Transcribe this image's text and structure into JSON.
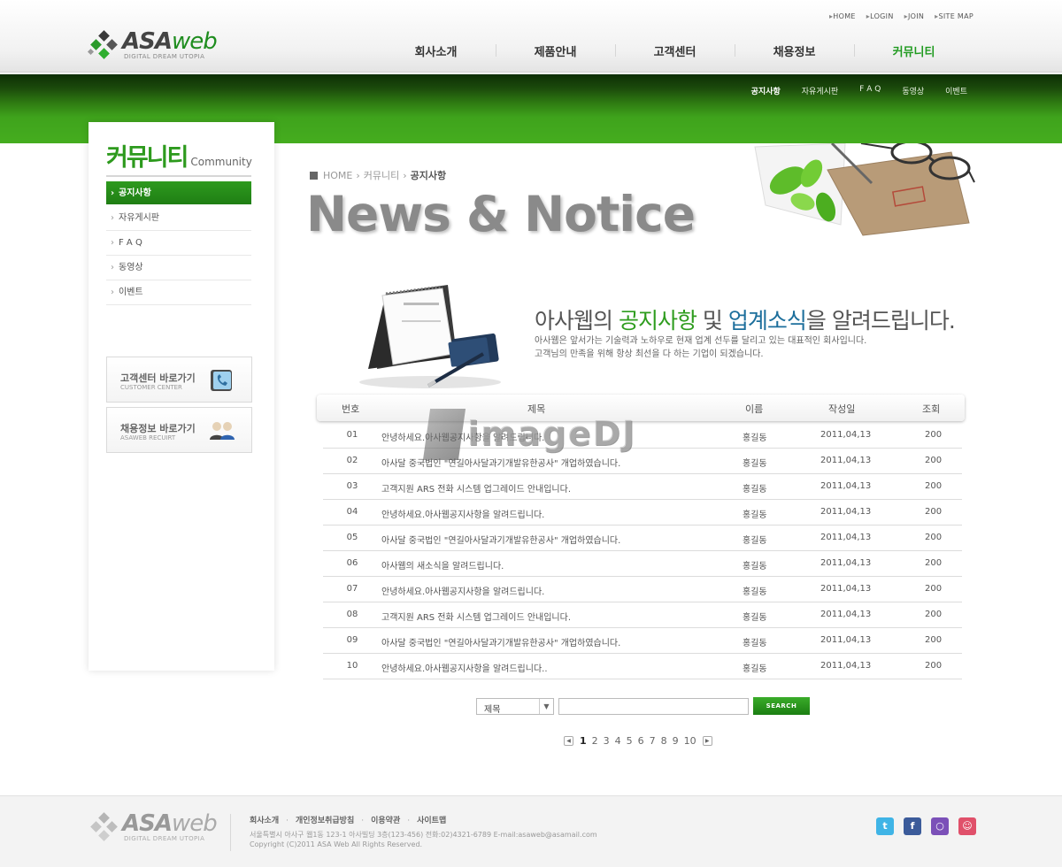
{
  "top_links": [
    "HOME",
    "LOGIN",
    "JOIN",
    "SITE MAP"
  ],
  "logo": {
    "main": "ASA",
    "accent": "web",
    "sub": "DIGITAL DREAM UTOPIA"
  },
  "gnb": [
    "회사소개",
    "제품안내",
    "고객센터",
    "채용정보",
    "커뮤니티"
  ],
  "gnb_active": "커뮤니티",
  "snb": [
    "공지사항",
    "자유게시판",
    "F A Q",
    "동영상",
    "이벤트"
  ],
  "lnb": {
    "title_kor": "커뮤니티",
    "title_eng": "Community",
    "items": [
      "공지사항",
      "자유게시판",
      "F A Q",
      "동영상",
      "이벤트"
    ]
  },
  "quick": [
    {
      "title": "고객센터 바로가기",
      "sub": "CUSTOMER CENTER",
      "icon": "phone-icon"
    },
    {
      "title": "채용정보 바로가기",
      "sub": "ASAWEB RECUIRT",
      "icon": "people-icon"
    }
  ],
  "breadcrumb": [
    "HOME",
    "커뮤니티",
    "공지사항"
  ],
  "page_title": "News & Notice",
  "headline": {
    "p1": "아사웹의 ",
    "p2": "공지사항",
    "p3": " 및 ",
    "p4": "업계소식",
    "p5": "을 알려드립니다."
  },
  "description": [
    "아사웹은 앞서가는 기술력과 노하우로 현재 업계 선두를 달리고 있는 대표적인 회사입니다.",
    "고객님의 만족을 위해 항상 최선을 다 하는 기업이 되겠습니다."
  ],
  "watermark": "imageDJ",
  "table": {
    "headers": [
      "번호",
      "제목",
      "이름",
      "작성일",
      "조회"
    ],
    "rows": [
      {
        "num": "01",
        "title": "안녕하세요.아사웹공지사항을 알려드립니다.",
        "name": "홍길동",
        "date": "2011,04,13",
        "views": "200"
      },
      {
        "num": "02",
        "title": "아사달 중국법인 \"연길아사달과기개발유한공사\" 개업하였습니다.",
        "name": "홍길동",
        "date": "2011,04,13",
        "views": "200"
      },
      {
        "num": "03",
        "title": "고객지원 ARS 전화 시스템 업그레이드 안내입니다.",
        "name": "홍길동",
        "date": "2011,04,13",
        "views": "200"
      },
      {
        "num": "04",
        "title": "안녕하세요.아사웹공지사항을 알려드립니다.",
        "name": "홍길동",
        "date": "2011,04,13",
        "views": "200"
      },
      {
        "num": "05",
        "title": "아사달 중국법인 \"연길아사달과기개발유한공사\" 개업하였습니다.",
        "name": "홍길동",
        "date": "2011,04,13",
        "views": "200"
      },
      {
        "num": "06",
        "title": "아사웹의 새소식을 알려드립니다.",
        "name": "홍길동",
        "date": "2011,04,13",
        "views": "200"
      },
      {
        "num": "07",
        "title": "안녕하세요.아사웹공지사항을 알려드립니다.",
        "name": "홍길동",
        "date": "2011,04,13",
        "views": "200"
      },
      {
        "num": "08",
        "title": "고객지원 ARS 전화 시스템 업그레이드 안내입니다.",
        "name": "홍길동",
        "date": "2011,04,13",
        "views": "200"
      },
      {
        "num": "09",
        "title": "아사달 중국법인 \"연길아사달과기개발유한공사\" 개업하였습니다.",
        "name": "홍길동",
        "date": "2011,04,13",
        "views": "200"
      },
      {
        "num": "10",
        "title": "안녕하세요.아사웹공지사항을 알려드립니다..",
        "name": "홍길동",
        "date": "2011,04,13",
        "views": "200"
      }
    ]
  },
  "search": {
    "select_value": "제목",
    "input_value": "",
    "button_label": "SEARCH"
  },
  "pagination": {
    "pages": [
      "1",
      "2",
      "3",
      "4",
      "5",
      "6",
      "7",
      "8",
      "9",
      "10"
    ],
    "current": "1"
  },
  "footer": {
    "links": [
      "회사소개",
      "개인정보취급방침",
      "이용약관",
      "사이트맵"
    ],
    "address": "서울특별시 아사구 웹1동 123-1 아사빌딩 3층(123-456) 전화:02)4321-6789 E-mail:asaweb@asamail.com",
    "copyright": "Copyright (C)2011 ASA Web All Rights Reserved."
  },
  "social_icons": [
    "twitter-icon",
    "facebook-icon",
    "blog-icon",
    "me2day-icon"
  ],
  "colors": {
    "accent_green": "#2e9c1e",
    "accent_blue": "#1d6f9c",
    "band_dark": "#1b4a0b"
  }
}
